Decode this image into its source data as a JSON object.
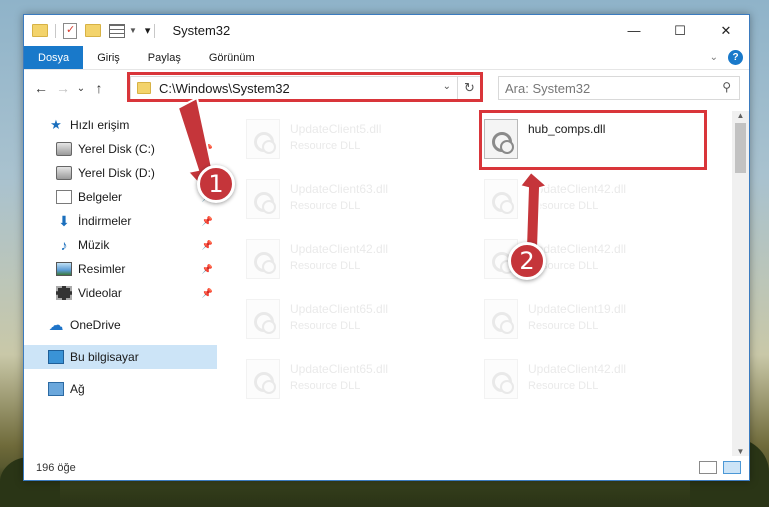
{
  "window": {
    "title": "System32",
    "buttons": {
      "minimize": "—",
      "maximize": "☐",
      "close": "✕"
    }
  },
  "ribbon": {
    "tabs": [
      "Dosya",
      "Giriş",
      "Paylaş",
      "Görünüm"
    ],
    "help": "?"
  },
  "navigation": {
    "back": "←",
    "forward": "→",
    "recent": "⌄",
    "up": "↑",
    "address": "C:\\Windows\\System32",
    "refresh": "↻",
    "search_placeholder": "Ara: System32"
  },
  "sidebar": {
    "items": [
      {
        "label": "Hızlı erişim",
        "icon": "star-icon"
      },
      {
        "label": "Yerel Disk (C:)",
        "icon": "disk-icon",
        "pinned": true
      },
      {
        "label": "Yerel Disk (D:)",
        "icon": "disk-icon",
        "pinned": true
      },
      {
        "label": "Belgeler",
        "icon": "documents-icon",
        "pinned": true
      },
      {
        "label": "İndirmeler",
        "icon": "download-icon",
        "pinned": true
      },
      {
        "label": "Müzik",
        "icon": "music-icon",
        "pinned": true
      },
      {
        "label": "Resimler",
        "icon": "pictures-icon",
        "pinned": true
      },
      {
        "label": "Videolar",
        "icon": "videos-icon",
        "pinned": true
      },
      {
        "label": "OneDrive",
        "icon": "cloud-icon"
      },
      {
        "label": "Bu bilgisayar",
        "icon": "computer-icon",
        "selected": true
      },
      {
        "label": "Ağ",
        "icon": "network-icon"
      }
    ]
  },
  "files": [
    {
      "name": "UpdateClient5.dll",
      "type": "Resource DLL"
    },
    {
      "name": "hub_comps.dll",
      "type": ""
    },
    {
      "name": "UpdateClient63.dll",
      "type": "Resource DLL"
    },
    {
      "name": "UpdateClient42.dll",
      "type": "Resource DLL"
    },
    {
      "name": "UpdateClient42.dll",
      "type": "Resource DLL"
    },
    {
      "name": "UpdateClient42.dll",
      "type": "Resource DLL"
    },
    {
      "name": "UpdateClient65.dll",
      "type": "Resource DLL"
    },
    {
      "name": "UpdateClient19.dll",
      "type": "Resource DLL"
    },
    {
      "name": "UpdateClient65.dll",
      "type": "Resource DLL"
    },
    {
      "name": "UpdateClient42.dll",
      "type": "Resource DLL"
    }
  ],
  "status": {
    "item_count": "196 öğe"
  },
  "annotations": {
    "badge1": "1",
    "badge2": "2",
    "color": "#c5353a"
  }
}
